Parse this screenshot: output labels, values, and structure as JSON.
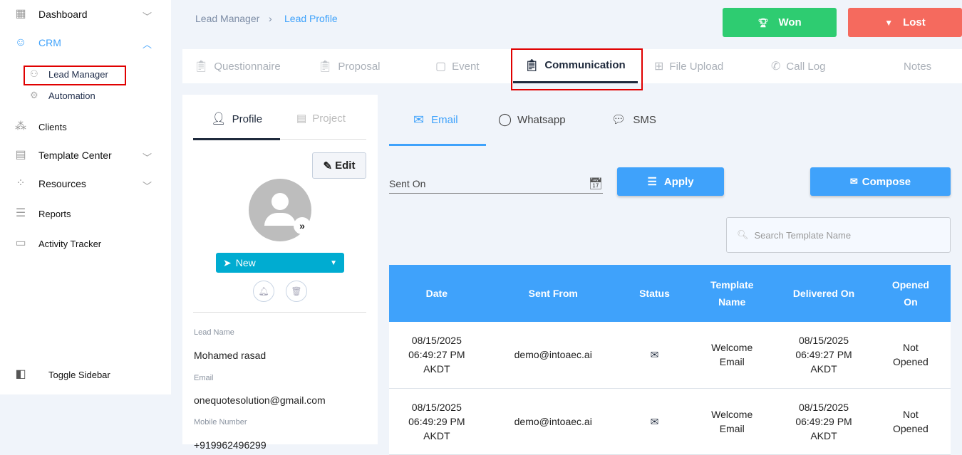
{
  "sidebar": {
    "items": [
      {
        "label": "Dashboard"
      },
      {
        "label": "CRM"
      },
      {
        "label": "Lead Manager"
      },
      {
        "label": "Automation"
      },
      {
        "label": "Clients"
      },
      {
        "label": "Template Center"
      },
      {
        "label": "Resources"
      },
      {
        "label": "Reports"
      },
      {
        "label": "Activity Tracker"
      }
    ],
    "toggle": "Toggle Sidebar"
  },
  "breadcrumb": {
    "parent": "Lead Manager",
    "current": "Lead Profile"
  },
  "actions": {
    "won": "Won",
    "lost": "Lost"
  },
  "tabs": [
    "Questionnaire",
    "Proposal",
    "Event",
    "Communication",
    "File Upload",
    "Call Log",
    "Notes"
  ],
  "profile": {
    "tabs": [
      "Profile",
      "Project"
    ],
    "edit": "Edit",
    "status": "New",
    "fields": [
      {
        "label": "Lead Name",
        "value": "Mohamed rasad"
      },
      {
        "label": "Email",
        "value": "onequotesolution@gmail.com"
      },
      {
        "label": "Mobile Number",
        "value": "+919962496299"
      }
    ]
  },
  "comm": {
    "channels": [
      "Email",
      "Whatsapp",
      "SMS"
    ],
    "sent_on": "Sent On",
    "apply": "Apply",
    "compose": "Compose",
    "search_placeholder": "Search Template Name"
  },
  "table": {
    "headers": [
      "Date",
      "Sent From",
      "Status",
      "Template Name",
      "Delivered On",
      "Opened On"
    ],
    "rows": [
      {
        "date": "08/15/2025 06:49:27 PM AKDT",
        "from": "demo@intoaec.ai",
        "template": "Welcome Email",
        "delivered": "08/15/2025 06:49:27 PM AKDT",
        "opened": "Not Opened"
      },
      {
        "date": "08/15/2025 06:49:29 PM AKDT",
        "from": "demo@intoaec.ai",
        "template": "Welcome Email",
        "delivered": "08/15/2025 06:49:29 PM AKDT",
        "opened": "Not Opened"
      }
    ]
  },
  "colors": {
    "accent": "#3fa2fb",
    "won": "#2ecc71",
    "lost": "#f56a5e",
    "status": "#00acd1"
  }
}
